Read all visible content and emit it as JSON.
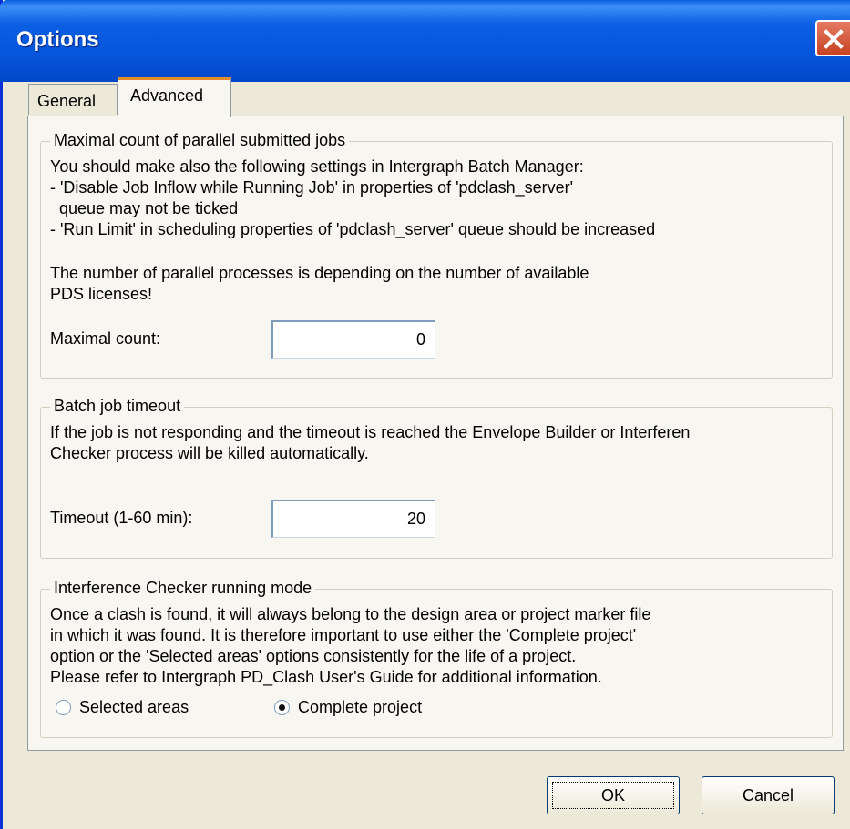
{
  "window": {
    "title": "Options"
  },
  "tabs": [
    {
      "label": "General",
      "active": false
    },
    {
      "label": "Advanced",
      "active": true
    }
  ],
  "parallel_jobs": {
    "legend": "Maximal count of parallel submitted jobs",
    "lines": [
      "You should make also the following settings in Intergraph Batch Manager:",
      "- 'Disable Job Inflow while Running Job' in properties of 'pdclash_server'",
      "  queue may not be ticked",
      "- 'Run Limit' in scheduling properties of 'pdclash_server' queue should be increased",
      "The number of parallel processes is depending on the number of available",
      "PDS licenses!"
    ],
    "field_label": "Maximal count:",
    "field_value": "0"
  },
  "batch_timeout": {
    "legend": "Batch job timeout",
    "lines": [
      "If the job is not responding and the timeout is reached the Envelope Builder or Interferen",
      "Checker process will be killed automatically."
    ],
    "field_label": "Timeout (1-60 min):",
    "field_value": "20"
  },
  "running_mode": {
    "legend": "Interference Checker running mode",
    "lines": [
      "Once a clash is found, it will always belong to the design area or project marker file",
      "in which it was found. It is therefore important to use either the 'Complete project'",
      "option or the 'Selected areas' options consistently for the life of a project.",
      "Please refer to Intergraph PD_Clash User's Guide for additional information."
    ],
    "options": [
      {
        "label": "Selected areas",
        "selected": false
      },
      {
        "label": "Complete project",
        "selected": true
      }
    ]
  },
  "buttons": {
    "ok": "OK",
    "cancel": "Cancel"
  }
}
